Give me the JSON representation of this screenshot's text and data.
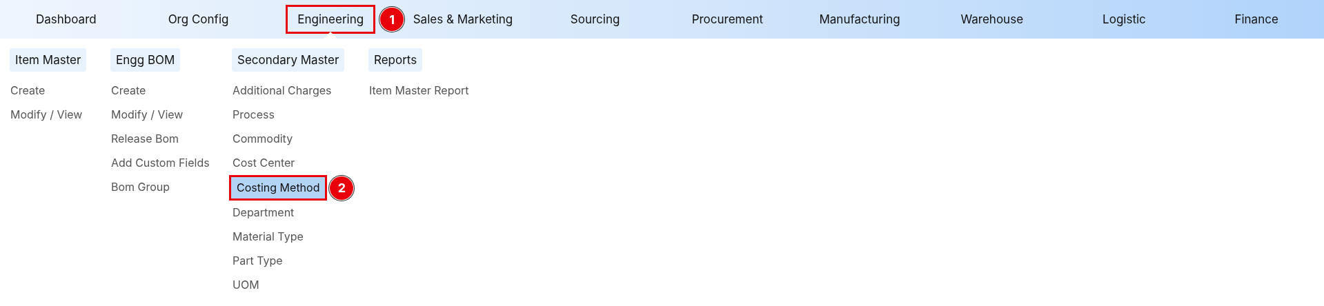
{
  "nav": [
    {
      "label": "Dashboard",
      "selected": false
    },
    {
      "label": "Org Config",
      "selected": false
    },
    {
      "label": "Engineering",
      "selected": true,
      "callout": "1"
    },
    {
      "label": "Sales & Marketing",
      "selected": false
    },
    {
      "label": "Sourcing",
      "selected": false
    },
    {
      "label": "Procurement",
      "selected": false
    },
    {
      "label": "Manufacturing",
      "selected": false
    },
    {
      "label": "Warehouse",
      "selected": false
    },
    {
      "label": "Logistic",
      "selected": false
    },
    {
      "label": "Finance",
      "selected": false
    }
  ],
  "menu": [
    {
      "heading": "Item Master",
      "items": [
        {
          "label": "Create",
          "selected": false
        },
        {
          "label": "Modify / View",
          "selected": false
        }
      ]
    },
    {
      "heading": "Engg BOM",
      "items": [
        {
          "label": "Create",
          "selected": false
        },
        {
          "label": "Modify / View",
          "selected": false
        },
        {
          "label": "Release Bom",
          "selected": false
        },
        {
          "label": "Add Custom Fields",
          "selected": false
        },
        {
          "label": "Bom Group",
          "selected": false
        }
      ]
    },
    {
      "heading": "Secondary Master",
      "items": [
        {
          "label": "Additional Charges",
          "selected": false
        },
        {
          "label": "Process",
          "selected": false
        },
        {
          "label": "Commodity",
          "selected": false
        },
        {
          "label": "Cost Center",
          "selected": false
        },
        {
          "label": "Costing Method",
          "selected": true,
          "callout": "2"
        },
        {
          "label": "Department",
          "selected": false
        },
        {
          "label": "Material Type",
          "selected": false
        },
        {
          "label": "Part Type",
          "selected": false
        },
        {
          "label": "UOM",
          "selected": false
        }
      ]
    },
    {
      "heading": "Reports",
      "items": [
        {
          "label": "Item Master Report",
          "selected": false
        }
      ]
    }
  ]
}
